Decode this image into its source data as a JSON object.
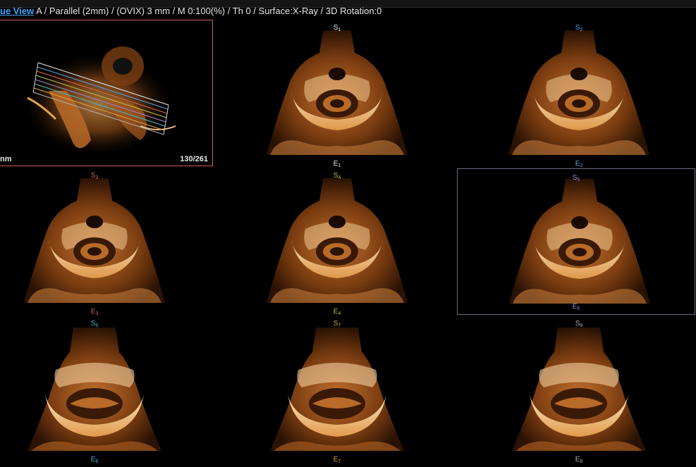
{
  "header": {
    "view_label": "ue View",
    "params_text": " A / Parallel (2mm) / (OVIX) 3 mm / M 0:100(%) / Th 0 / Surface:X-Ray / 3D Rotation:0"
  },
  "reference": {
    "scale_label": "nm",
    "slice_counter": "130/261"
  },
  "slices": [
    {
      "start": "S",
      "end": "E",
      "index": "1",
      "color": "#f0f0f0"
    },
    {
      "start": "S",
      "end": "E",
      "index": "2",
      "color": "#5aa0e6"
    },
    {
      "start": "S",
      "end": "E",
      "index": "3",
      "color": "#d96a4a"
    },
    {
      "start": "S",
      "end": "E",
      "index": "4",
      "color": "#b8c24a"
    },
    {
      "start": "S",
      "end": "E",
      "index": "5",
      "color": "#9a8ad8"
    },
    {
      "start": "S",
      "end": "E",
      "index": "6",
      "color": "#4ab8c8"
    },
    {
      "start": "S",
      "end": "E",
      "index": "7",
      "color": "#e0a040"
    },
    {
      "start": "S",
      "end": "E",
      "index": "8",
      "color": "#b0b0b0"
    }
  ],
  "colors": {
    "reference_border": "#c9634b",
    "selected_border": "#6d6d80",
    "link": "#3fa6ff"
  }
}
